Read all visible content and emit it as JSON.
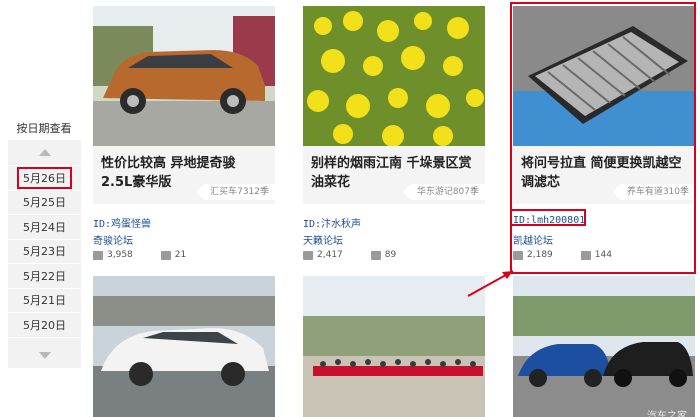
{
  "date_nav": {
    "title": "按日期查看",
    "dates": [
      "5月26日",
      "5月25日",
      "5月24日",
      "5月23日",
      "5月22日",
      "5月21日",
      "5月20日"
    ],
    "active_index": 0,
    "up_icon": "triangle-up-icon",
    "down_icon": "triangle-down-icon"
  },
  "cards": [
    {
      "title": "性价比较高 异地提奇骏2.5L豪华版",
      "source": "汇买车7312季",
      "author": "ID:鸡蛋怪兽",
      "forum": "奇骏论坛",
      "views": "3,958",
      "comments": "21",
      "image": "orange-suv-photo"
    },
    {
      "title": "别样的烟雨江南 千垛景区赏油菜花",
      "source": "华东游记807季",
      "author": "ID:汴水秋声",
      "forum": "天籁论坛",
      "views": "2,417",
      "comments": "89",
      "image": "rapeseed-flowers-photo"
    },
    {
      "title": "将问号拉直 简便更换凯越空调滤芯",
      "source": "养车有道310季",
      "author": "ID:lmh200801",
      "forum": "凯越论坛",
      "views": "2,189",
      "comments": "144",
      "image": "cabin-air-filter-photo"
    }
  ],
  "bottom_images": [
    "white-sedan-photo",
    "group-photo-with-banners",
    "blue-and-black-cars-photo"
  ],
  "watermark": "汽车之家",
  "colors": {
    "highlight": "#d9001b",
    "link": "#1a4d99",
    "title_bg": "#f4f4f4"
  }
}
